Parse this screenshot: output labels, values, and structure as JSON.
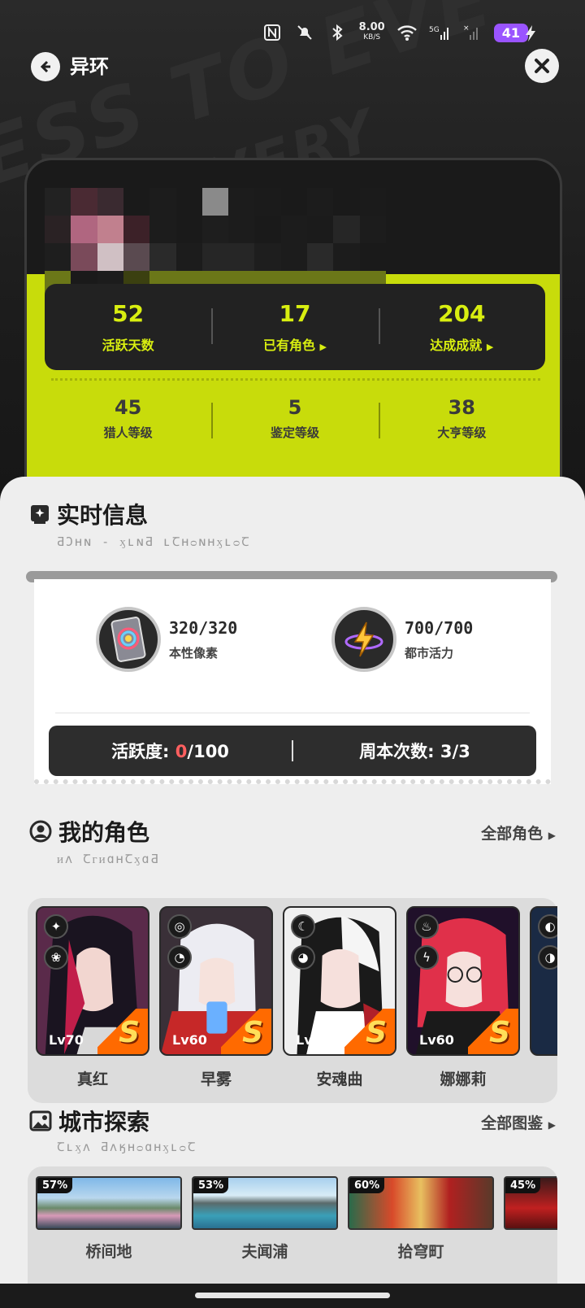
{
  "header": {
    "title": "异环"
  },
  "status_bar": {
    "speed_value": "8.00",
    "speed_unit": "KB/S",
    "battery": "41"
  },
  "profile": {
    "top_stats": [
      {
        "value": "52",
        "label": "活跃天数",
        "has_arrow": false
      },
      {
        "value": "17",
        "label": "已有角色",
        "has_arrow": true
      },
      {
        "value": "204",
        "label": "达成成就",
        "has_arrow": true
      }
    ],
    "bottom_stats": [
      {
        "value": "45",
        "label": "猎人等级"
      },
      {
        "value": "5",
        "label": "鉴定等级"
      },
      {
        "value": "38",
        "label": "大亨等级"
      }
    ]
  },
  "realtime": {
    "title": "实时信息",
    "subtitle": "ƋƆʜɴ - ӽʟɴƋ ʟꞆʜᴑɴʜӽʟᴑꞆ",
    "resources": [
      {
        "value": "320/320",
        "label": "本性像素",
        "icon": "pixel-card-icon"
      },
      {
        "value": "700/700",
        "label": "都市活力",
        "icon": "lightning-orb-icon"
      }
    ],
    "activity_label": "活跃度:",
    "activity_current": "0",
    "activity_total": "/100",
    "weekly_label": "周本次数:",
    "weekly_value": "3/3"
  },
  "characters": {
    "title": "我的角色",
    "subtitle": "ᴎʌ ꞆᴦᴎɑʜꞆӽɑƋ",
    "more_label": "全部角色",
    "items": [
      {
        "name": "真红",
        "level": "Lv70",
        "rank": "S",
        "accent": "#d23a5a"
      },
      {
        "name": "早雾",
        "level": "Lv60",
        "rank": "S",
        "accent": "#d83a2e"
      },
      {
        "name": "安魂曲",
        "level": "Lv60",
        "rank": "S",
        "accent": "#d0d0e0"
      },
      {
        "name": "娜娜莉",
        "level": "Lv60",
        "rank": "S",
        "accent": "#e0304a"
      }
    ]
  },
  "city": {
    "title": "城市探索",
    "subtitle": "Ꞇʟӽʌ ƋʌӄʜᴑɑʜӽʟᴑꞆ",
    "more_label": "全部图鉴",
    "areas": [
      {
        "name": "桥间地",
        "percent": "57%"
      },
      {
        "name": "夫闻浦",
        "percent": "53%"
      },
      {
        "name": "拾穹町",
        "percent": "60%"
      },
      {
        "name": "",
        "percent": "45%"
      }
    ]
  },
  "colors": {
    "accent_lime": "#c8dc0b",
    "stat_text": "#d8ee10",
    "battery": "#9a54ff",
    "activity_red": "#ff5f5f"
  }
}
